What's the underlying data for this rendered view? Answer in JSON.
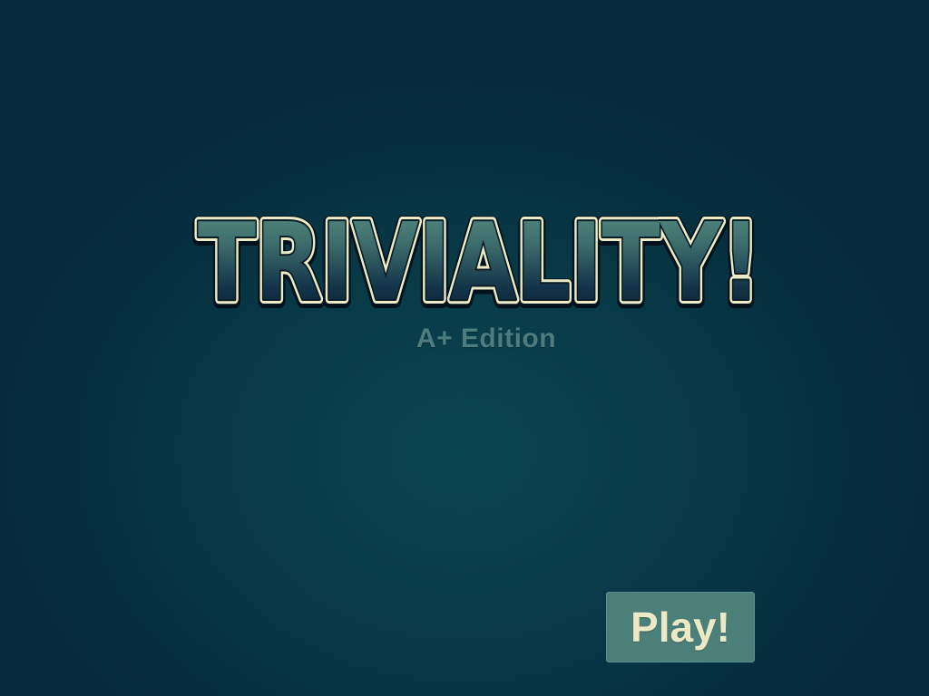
{
  "title": {
    "logo_text": "TRIVIALITY!",
    "subtitle": "A+ Edition"
  },
  "actions": {
    "play_label": "Play!"
  },
  "colors": {
    "background": "#07384a",
    "logo_top": "#4c7f78",
    "logo_bottom": "#082236",
    "logo_outline": "#ecebc8",
    "subtitle": "#4d7c7e",
    "play_button": "#4b7f79",
    "play_text": "#ece9c6"
  }
}
